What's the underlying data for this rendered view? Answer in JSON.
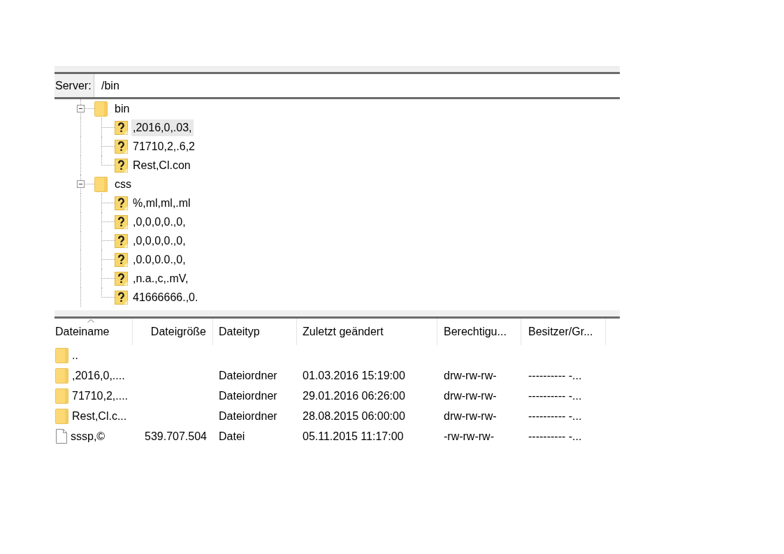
{
  "remote_site": {
    "label": "Server:",
    "path": "/bin"
  },
  "tree": [
    {
      "kind": "folder",
      "label": "bin",
      "expanded": true,
      "selected": false,
      "children": [
        {
          "kind": "unknown",
          "label": ",2016,0,.03,",
          "selected": true
        },
        {
          "kind": "unknown",
          "label": "71710,2,.6,2",
          "selected": false
        },
        {
          "kind": "unknown",
          "label": "Rest,Cl.con",
          "selected": false
        }
      ]
    },
    {
      "kind": "folder",
      "label": "css",
      "expanded": true,
      "selected": false,
      "children": [
        {
          "kind": "unknown",
          "label": "%,ml,ml,.ml",
          "selected": false
        },
        {
          "kind": "unknown",
          "label": ",0,0,0,0.,0,",
          "selected": false
        },
        {
          "kind": "unknown",
          "label": ",0,0,0,0.,0,",
          "selected": false
        },
        {
          "kind": "unknown",
          "label": ",0.0,0.0.,0,",
          "selected": false
        },
        {
          "kind": "unknown",
          "label": ",n.a.,c,.mV,",
          "selected": false
        },
        {
          "kind": "unknown",
          "label": "41666666.,0.",
          "selected": false
        }
      ]
    }
  ],
  "file_list": {
    "columns": [
      {
        "label": "Dateiname",
        "sorted": true
      },
      {
        "label": "Dateigröße",
        "sorted": false
      },
      {
        "label": "Dateityp",
        "sorted": false
      },
      {
        "label": "Zuletzt geändert",
        "sorted": false
      },
      {
        "label": "Berechtigu...",
        "sorted": false
      },
      {
        "label": "Besitzer/Gr...",
        "sorted": false
      }
    ],
    "rows": [
      {
        "kind": "folder",
        "selected": false,
        "name": ".."
      },
      {
        "kind": "folder",
        "selected": false,
        "name": ",2016,0,....",
        "type": "Dateiordner",
        "modified": "01.03.2016 15:19:00",
        "permissions": "drw-rw-rw-",
        "owner": "---------- -..."
      },
      {
        "kind": "folder",
        "selected": false,
        "name": "71710,2,....",
        "type": "Dateiordner",
        "modified": "29.01.2016 06:26:00",
        "permissions": "drw-rw-rw-",
        "owner": "---------- -..."
      },
      {
        "kind": "folder",
        "selected": false,
        "name": "Rest,Cl.c...",
        "type": "Dateiordner",
        "modified": "28.08.2015 06:00:00",
        "permissions": "drw-rw-rw-",
        "owner": "---------- -..."
      },
      {
        "kind": "file",
        "selected": false,
        "name": "sssp,©",
        "size": "539.707.504",
        "type": "Datei",
        "modified": "05.11.2015 11:17:00",
        "permissions": "-rw-rw-rw-",
        "owner": "---------- -..."
      }
    ]
  }
}
